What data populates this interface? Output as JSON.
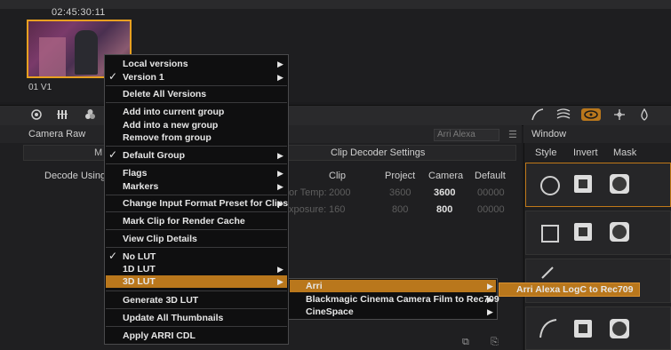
{
  "thumbnail": {
    "timecode": "02:45:30:11",
    "clip_label": "01  V1"
  },
  "camera_raw": {
    "title": "Camera Raw",
    "camera_select": "Arri Alexa",
    "sub_m": "M",
    "section_title": "Clip Decoder Settings",
    "decode_using": "Decode Using:",
    "columns": [
      "Clip",
      "Project",
      "Camera",
      "Default"
    ],
    "rows": [
      {
        "label": "or Temp:",
        "clip": "2000",
        "project": "3600",
        "camera": "3600",
        "default": "00000"
      },
      {
        "label": "xposure:",
        "clip": "160",
        "project": "800",
        "camera": "800",
        "default": "00000"
      }
    ]
  },
  "window_panel": {
    "title": "Window",
    "columns": [
      "Style",
      "Invert",
      "Mask"
    ]
  },
  "context_menu": {
    "items": [
      {
        "label": "Local versions",
        "submenu": true
      },
      {
        "label": "Version 1",
        "submenu": true,
        "checked": true
      },
      {
        "label": "Delete All Versions"
      },
      {
        "label": "Add into current group"
      },
      {
        "label": "Add into a new group"
      },
      {
        "label": "Remove from group"
      },
      {
        "label": "Default Group",
        "submenu": true,
        "checked": true
      },
      {
        "label": "Flags",
        "submenu": true
      },
      {
        "label": "Markers",
        "submenu": true
      },
      {
        "label": "Change Input Format Preset for Clips",
        "submenu": true
      },
      {
        "label": "Mark Clip for Render Cache"
      },
      {
        "label": "View Clip Details"
      },
      {
        "label": "No LUT",
        "checked": true
      },
      {
        "label": "1D LUT",
        "submenu": true
      },
      {
        "label": "3D LUT",
        "submenu": true,
        "highlighted": true
      },
      {
        "label": "Generate 3D LUT"
      },
      {
        "label": "Update All Thumbnails"
      },
      {
        "label": "Apply ARRI CDL"
      }
    ],
    "submenu_3dlut": [
      {
        "label": "Arri",
        "highlighted": true
      },
      {
        "label": "Blackmagic Cinema Camera Film to Rec709"
      },
      {
        "label": "CineSpace"
      }
    ],
    "submenu_arri": [
      {
        "label": "Arri Alexa LogC to Rec709",
        "highlighted": true
      }
    ]
  },
  "colors": {
    "accent": "#b9771c",
    "selection_border": "#e8a020"
  }
}
